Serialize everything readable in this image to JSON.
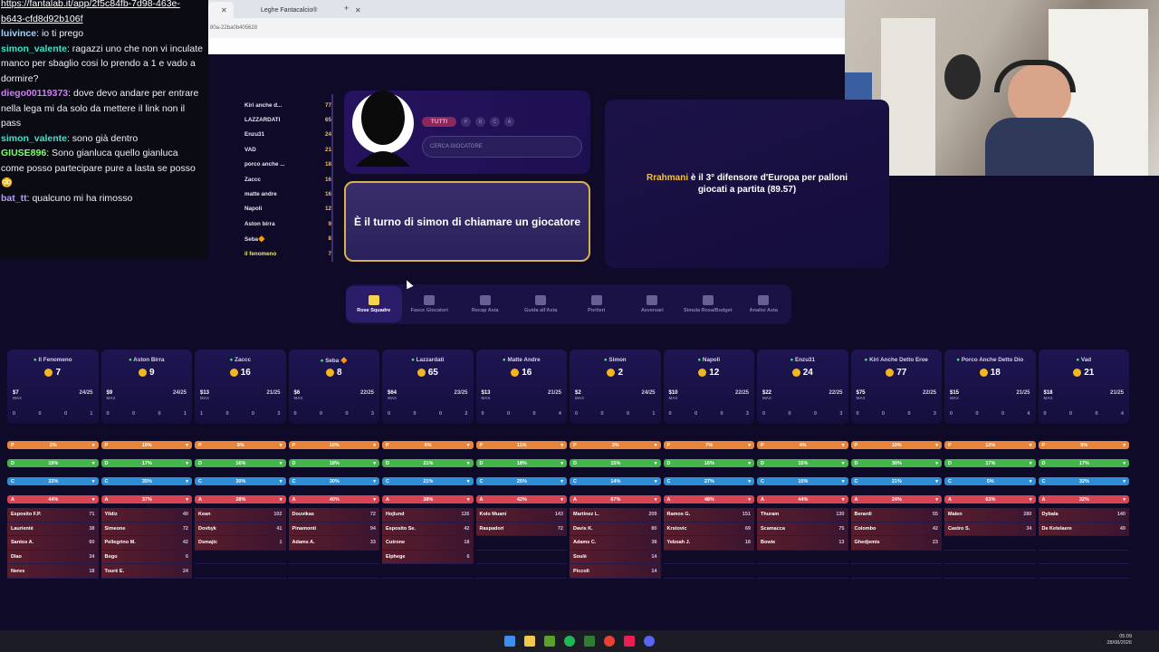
{
  "browser": {
    "tabs": [
      {
        "label": ""
      },
      {
        "label": "Leghe Fantacalcio®"
      }
    ],
    "address": "80a-22ba0b405628"
  },
  "chat": {
    "link": "https://fantalab.it/app/2f5c84fb-7d98-463e-b643-cfd8d92b106f",
    "messages": [
      {
        "user": "luivince",
        "color": "#9ad7ff",
        "text": "io ti prego"
      },
      {
        "user": "simon_valente",
        "color": "#39e6c9",
        "text": "ragazzi uno che non vi inculate manco per sbaglio cosi lo prendo a 1 e vado a dormire?"
      },
      {
        "user": "diego00119373",
        "color": "#d37cff",
        "text": "dove devo andare per entrare nella lega mi da solo da mettere il link non il pass"
      },
      {
        "user": "simon_valente",
        "color": "#39e6c9",
        "text": "sono già dentro"
      },
      {
        "user": "GIUSE896",
        "color": "#7cff6a",
        "text": "Sono gianluca quello gianluca come posso partecipare pure a lasta se posso 😳"
      },
      {
        "user": "bat_tt",
        "color": "#b49bff",
        "text": "qualcuno mi ha rimosso"
      }
    ]
  },
  "ranking": [
    {
      "name": "Kiri anche d...",
      "value": "77"
    },
    {
      "name": "LAZZARDATI",
      "value": "65"
    },
    {
      "name": "Enzu31",
      "value": "24"
    },
    {
      "name": "VAD",
      "value": "21"
    },
    {
      "name": "porco anche ...",
      "value": "18"
    },
    {
      "name": "Zaccc",
      "value": "16"
    },
    {
      "name": "matte andre",
      "value": "16"
    },
    {
      "name": "Napoli",
      "value": "12"
    },
    {
      "name": "Aston birra",
      "value": "9"
    },
    {
      "name": "Seba🔶",
      "value": "8"
    },
    {
      "name": "il fenomeno",
      "value": "7"
    }
  ],
  "player": {
    "filter_all": "TUTTI",
    "filters": [
      "P",
      "D",
      "C",
      "A"
    ],
    "search_placeholder": "CERCA GIOCATORE"
  },
  "turn_message": "È il turno di simon di chiamare un giocatore",
  "fact": {
    "name": "Rrahmani",
    "text": " è il 3° difensore d'Europa per palloni giocati a partita ",
    "value": "(89.57)"
  },
  "toolbar": [
    {
      "label": "Rose Squadre",
      "active": true
    },
    {
      "label": "Fasce Giocatori",
      "active": false
    },
    {
      "label": "Recap Asta",
      "active": false
    },
    {
      "label": "Guida all'Asta",
      "active": false
    },
    {
      "label": "Portieri",
      "active": false
    },
    {
      "label": "Avversari",
      "active": false
    },
    {
      "label": "Simula Rosa/Budget",
      "active": false
    },
    {
      "label": "Analisi Asta",
      "active": false
    }
  ],
  "teams": [
    {
      "name": "Il Fenomeno",
      "credits": "7",
      "max": "$7",
      "count": "24/25",
      "roles": [
        "0",
        "0",
        "0",
        "1"
      ]
    },
    {
      "name": "Aston Birra",
      "credits": "9",
      "max": "$9",
      "count": "24/25",
      "roles": [
        "0",
        "0",
        "0",
        "1"
      ]
    },
    {
      "name": "Zaccc",
      "credits": "16",
      "max": "$13",
      "count": "21/25",
      "roles": [
        "1",
        "0",
        "0",
        "3"
      ]
    },
    {
      "name": "Seba 🔶",
      "credits": "8",
      "max": "$6",
      "count": "22/25",
      "roles": [
        "0",
        "0",
        "0",
        "3"
      ]
    },
    {
      "name": "Lazzardati",
      "credits": "65",
      "max": "$64",
      "count": "23/25",
      "roles": [
        "0",
        "0",
        "0",
        "2"
      ]
    },
    {
      "name": "Matte Andre",
      "credits": "16",
      "max": "$13",
      "count": "21/25",
      "roles": [
        "0",
        "0",
        "0",
        "4"
      ]
    },
    {
      "name": "Simon",
      "credits": "2",
      "max": "$2",
      "count": "24/25",
      "roles": [
        "0",
        "0",
        "0",
        "1"
      ]
    },
    {
      "name": "Napoli",
      "credits": "12",
      "max": "$10",
      "count": "22/25",
      "roles": [
        "0",
        "0",
        "0",
        "3"
      ]
    },
    {
      "name": "Enzu31",
      "credits": "24",
      "max": "$22",
      "count": "22/25",
      "roles": [
        "0",
        "0",
        "0",
        "3"
      ]
    },
    {
      "name": "Kiri Anche Detto Eroe",
      "credits": "77",
      "max": "$75",
      "count": "22/25",
      "roles": [
        "0",
        "0",
        "0",
        "3"
      ]
    },
    {
      "name": "Porco Anche Detto Dio",
      "credits": "18",
      "max": "$15",
      "count": "21/25",
      "roles": [
        "0",
        "0",
        "0",
        "4"
      ]
    },
    {
      "name": "Vad",
      "credits": "21",
      "max": "$18",
      "count": "21/25",
      "roles": [
        "0",
        "0",
        "0",
        "4"
      ]
    }
  ],
  "role_bars": {
    "P": [
      "2%",
      "10%",
      "9%",
      "10%",
      "6%",
      "11%",
      "3%",
      "7%",
      "4%",
      "10%",
      "12%",
      "9%"
    ],
    "D": [
      "19%",
      "17%",
      "16%",
      "18%",
      "21%",
      "18%",
      "15%",
      "16%",
      "15%",
      "30%",
      "17%",
      "17%"
    ],
    "C": [
      "33%",
      "35%",
      "30%",
      "30%",
      "21%",
      "25%",
      "14%",
      "27%",
      "15%",
      "21%",
      "5%",
      "32%"
    ],
    "A": [
      "44%",
      "37%",
      "28%",
      "40%",
      "38%",
      "42%",
      "67%",
      "48%",
      "44%",
      "24%",
      "63%",
      "32%"
    ]
  },
  "rosters": [
    [
      {
        "n": "Esposito F.P.",
        "c": "71"
      },
      {
        "n": "Laurientè",
        "c": "38"
      },
      {
        "n": "Santos A.",
        "c": "60"
      },
      {
        "n": "Dlao",
        "c": "34"
      },
      {
        "n": "Neres",
        "c": "18"
      }
    ],
    [
      {
        "n": "Yildiz",
        "c": "40"
      },
      {
        "n": "Simeone",
        "c": "72"
      },
      {
        "n": "Pellegrino M.",
        "c": "42"
      },
      {
        "n": "Bogo",
        "c": "6"
      },
      {
        "n": "Tourè E.",
        "c": "24"
      }
    ],
    [
      {
        "n": "Kean",
        "c": "102"
      },
      {
        "n": "Dovbyk",
        "c": "41"
      },
      {
        "n": "Dsmajic",
        "c": "1"
      }
    ],
    [
      {
        "n": "Douvikas",
        "c": "72"
      },
      {
        "n": "Pinamonti",
        "c": "94"
      },
      {
        "n": "Adams A.",
        "c": "33"
      }
    ],
    [
      {
        "n": "Hojlund",
        "c": "126"
      },
      {
        "n": "Esposito Se.",
        "c": "42"
      },
      {
        "n": "Cutrone",
        "c": "18"
      },
      {
        "n": "Elphege",
        "c": "6"
      }
    ],
    [
      {
        "n": "Kolo Muani",
        "c": "143"
      },
      {
        "n": "Raspadori",
        "c": "72"
      }
    ],
    [
      {
        "n": "Martinez L.",
        "c": "209"
      },
      {
        "n": "Davis K.",
        "c": "80"
      },
      {
        "n": "Adams C.",
        "c": "38"
      },
      {
        "n": "Soulè",
        "c": "14"
      },
      {
        "n": "Piccoli",
        "c": "14"
      }
    ],
    [
      {
        "n": "Ramos G.",
        "c": "151"
      },
      {
        "n": "Krstovic",
        "c": "69"
      },
      {
        "n": "Yeboah J.",
        "c": "18"
      }
    ],
    [
      {
        "n": "Thuram",
        "c": "130"
      },
      {
        "n": "Scamacca",
        "c": "75"
      },
      {
        "n": "Bowie",
        "c": "13"
      }
    ],
    [
      {
        "n": "Berardi",
        "c": "55"
      },
      {
        "n": "Colombo",
        "c": "42"
      },
      {
        "n": "Ghedjemis",
        "c": "23"
      }
    ],
    [
      {
        "n": "Malen",
        "c": "280"
      },
      {
        "n": "Castro S.",
        "c": "34"
      }
    ],
    [
      {
        "n": "Dybala",
        "c": "140"
      },
      {
        "n": "De Ketelaere",
        "c": "49"
      }
    ]
  ],
  "labels": {
    "max": "MAX",
    "role_p": "P",
    "role_d": "D",
    "role_c": "C",
    "role_a": "A"
  },
  "clock": {
    "time": "05:09",
    "date": "28/08/2026"
  },
  "colors": {
    "P": "#e8853a",
    "D": "#43b649",
    "C": "#2d8ed6",
    "A": "#d94452",
    "coin": "#f2b620",
    "accent": "#f5c04a"
  }
}
